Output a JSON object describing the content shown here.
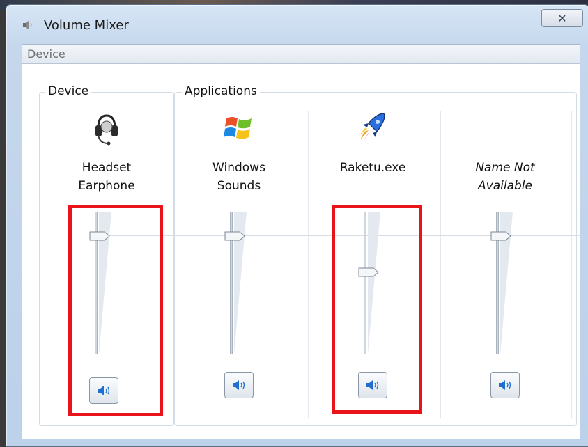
{
  "window": {
    "title": "Volume Mixer",
    "close_symbol": "✕"
  },
  "menu": {
    "items": [
      "Device"
    ]
  },
  "groups": {
    "device_label": "Device",
    "applications_label": "Applications"
  },
  "channels": [
    {
      "name_line1": "Headset",
      "name_line2": "Earphone",
      "icon": "headset-icon",
      "level_percent": 100,
      "highlighted": true
    },
    {
      "name_line1": "Windows",
      "name_line2": "Sounds",
      "icon": "windows-logo-icon",
      "level_percent": 100,
      "highlighted": false
    },
    {
      "name_line1": "Raketu.exe",
      "name_line2": "",
      "icon": "rocket-icon",
      "level_percent": 63,
      "highlighted": true
    },
    {
      "name_line1": "Name Not",
      "name_line2": "Available",
      "icon": "",
      "level_percent": 100,
      "highlighted": false,
      "italic": true
    }
  ],
  "colors": {
    "highlight": "#e8141a",
    "speaker_blue": "#1f6fd0"
  }
}
